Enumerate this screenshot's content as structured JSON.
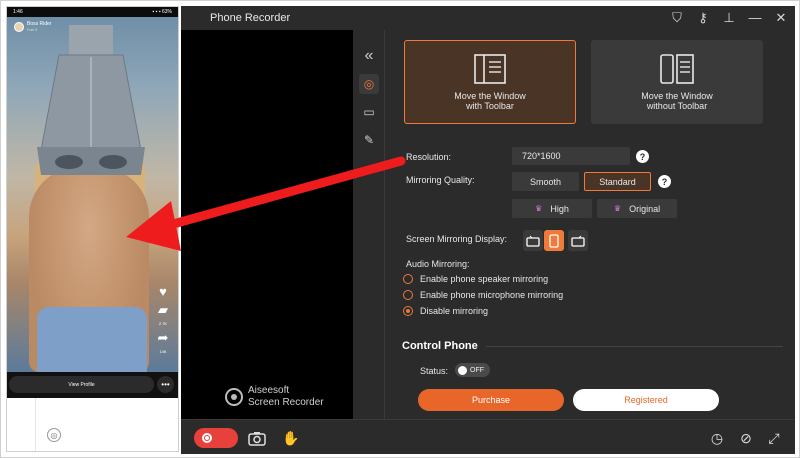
{
  "phone": {
    "status_time": "1:46",
    "status_right": "▪ ▪ ▪ 63%",
    "username": "Boss Rider",
    "user_sub": "Fab 9",
    "like_count": "",
    "comment_count": "2.7K",
    "share_count": "14K",
    "view_profile": "View Profile",
    "more_label": "•••"
  },
  "app": {
    "title": "Phone Recorder",
    "brand_line1": "Aiseesoft",
    "brand_line2": "Screen Recorder",
    "mode_toolbar": "Move the Window\nwith Toolbar",
    "mode_no_toolbar": "Move the Window\nwithout Toolbar",
    "resolution_label": "Resolution:",
    "resolution_value": "720*1600",
    "quality_label": "Mirroring Quality:",
    "quality_smooth": "Smooth",
    "quality_standard": "Standard",
    "quality_high": "High",
    "quality_original": "Original",
    "display_label": "Screen Mirroring Display:",
    "audio_label": "Audio Mirroring:",
    "audio_opt1": "Enable phone speaker mirroring",
    "audio_opt2": "Enable phone microphone mirroring",
    "audio_opt3": "Disable mirroring",
    "control_title": "Control Phone",
    "status_label": "Status:",
    "status_toggle": "OFF",
    "purchase": "Purchase",
    "registered": "Registered",
    "help": "?",
    "collapse": "«"
  },
  "colors": {
    "accent": "#f07a3a",
    "panel": "#2b2b2b",
    "arrow": "#ee1c1c"
  }
}
